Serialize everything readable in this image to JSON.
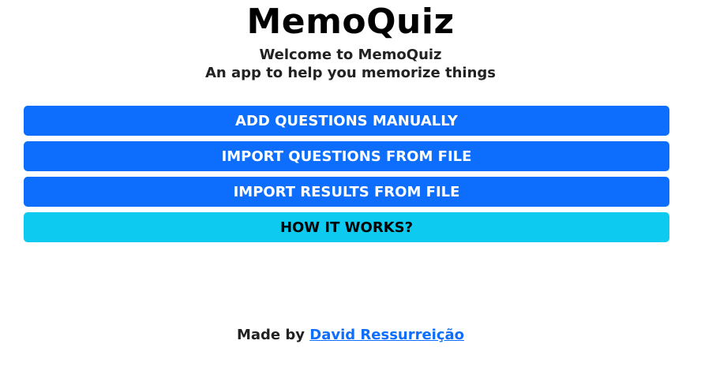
{
  "header": {
    "title": "MemoQuiz",
    "subtitle": "Welcome to MemoQuiz",
    "tagline": "An app to help you memorize things"
  },
  "actions": {
    "add_questions_label": "ADD QUESTIONS MANUALLY",
    "import_questions_label": "IMPORT QUESTIONS FROM FILE",
    "import_results_label": "IMPORT RESULTS FROM FILE",
    "how_it_works_label": "HOW IT WORKS?"
  },
  "footer": {
    "made_by_text": "Made by",
    "author_link_text": "David Ressurreição"
  },
  "colors": {
    "primary": "#0d6efd",
    "info": "#0dcaf0",
    "background": "#ffffff"
  }
}
